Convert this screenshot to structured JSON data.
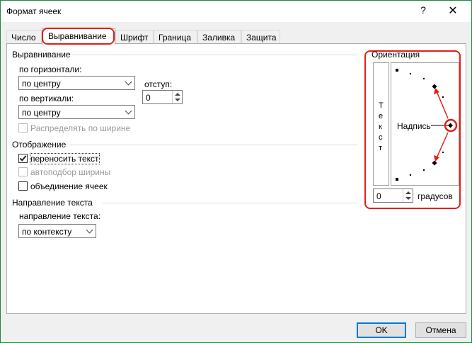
{
  "window": {
    "title": "Формат ячеек",
    "help_glyph": "?",
    "close_glyph": "✕"
  },
  "tabs": [
    {
      "label": "Число"
    },
    {
      "label": "Выравнивание",
      "active": true
    },
    {
      "label": "Шрифт"
    },
    {
      "label": "Граница"
    },
    {
      "label": "Заливка"
    },
    {
      "label": "Защита"
    }
  ],
  "alignment": {
    "group_title": "Выравнивание",
    "horizontal_label": "по горизонтали:",
    "horizontal_value": "по центру",
    "indent_label": "отступ:",
    "indent_value": "0",
    "vertical_label": "по вертикали:",
    "vertical_value": "по центру",
    "distribute_label": "Распределять по ширине"
  },
  "display": {
    "group_title": "Отображение",
    "wrap_text_label": "переносить текст",
    "wrap_text_checked": true,
    "shrink_label": "автоподбор ширины",
    "merge_label": "объединение ячеек"
  },
  "text_direction": {
    "group_title": "Направление текста",
    "direction_label": "направление текста:",
    "direction_value": "по контексту"
  },
  "orientation": {
    "group_title": "Ориентация",
    "vertical_text": [
      "Т",
      "е",
      "к",
      "с",
      "т"
    ],
    "dial_label": "Надпись",
    "degrees_value": "0",
    "degrees_label": "градусов"
  },
  "buttons": {
    "ok": "OK",
    "cancel": "Отмена"
  },
  "colors": {
    "highlight": "#e0201a",
    "default_button_border": "#0078d7"
  },
  "icons": {
    "help": "help-icon",
    "close": "close-icon",
    "dropdown": "chevron-down-icon",
    "spinner": "spinner-arrows-icon",
    "checkmark": "checkmark-icon"
  }
}
